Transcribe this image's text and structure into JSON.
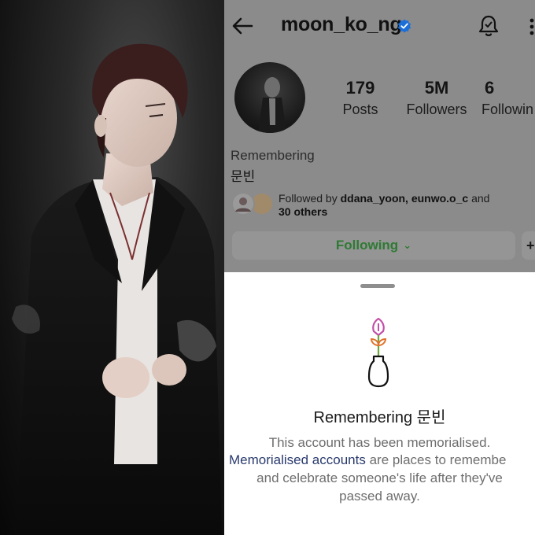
{
  "profile": {
    "username": "moon_ko_ng",
    "stats": {
      "posts_count": "179",
      "posts_label": "Posts",
      "followers_count": "5M",
      "followers_label": "Followers",
      "following_count": "6",
      "following_label": "Followin"
    },
    "remembering_label": "Remembering",
    "name": "문빈",
    "followed_by_prefix": "Followed by ",
    "followed_by_users": "ddana_yoon, eunwo.o_c",
    "followed_by_and": " and",
    "followed_by_others": "30 others",
    "following_button": "Following",
    "following_chevron": "⌄",
    "add_button": "+"
  },
  "sheet": {
    "title": "Remembering 문빈",
    "line1": "This account has been memorialised.",
    "link_text": "Memorialised accounts",
    "line2_rest": " are places to remembe",
    "line3": "and celebrate someone's life after they've",
    "line4": "passed away."
  },
  "colors": {
    "overlay_gray": "#8b8b8b",
    "following_green": "#2f7a34",
    "verified_blue": "#1d6fd8",
    "link_navy": "#2a3b6e",
    "flower_pink": "#c24fa8",
    "flower_orange": "#e0722a",
    "leaf_green": "#6ea83c"
  },
  "icons": [
    "back-arrow-icon",
    "verified-badge-icon",
    "bell-icon",
    "more-options-icon",
    "memorial-vase-icon"
  ]
}
